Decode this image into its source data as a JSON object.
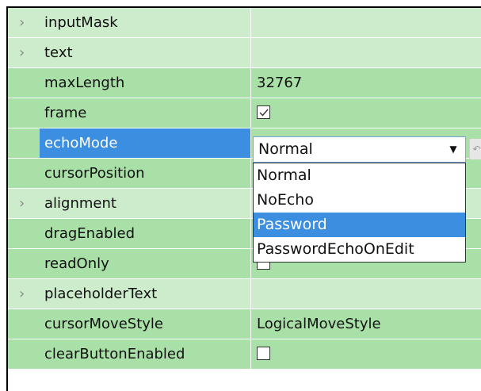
{
  "properties": [
    {
      "name": "inputMask",
      "value": "",
      "expandable": true,
      "kind": "text"
    },
    {
      "name": "text",
      "value": "",
      "expandable": true,
      "kind": "text"
    },
    {
      "name": "maxLength",
      "value": "32767",
      "expandable": false,
      "kind": "text"
    },
    {
      "name": "frame",
      "value": "",
      "expandable": false,
      "kind": "checkbox",
      "checked": true
    },
    {
      "name": "echoMode",
      "value": "",
      "expandable": false,
      "kind": "combo",
      "selected": true
    },
    {
      "name": "cursorPosition",
      "value": "",
      "expandable": false,
      "kind": "text"
    },
    {
      "name": "alignment",
      "value": "",
      "expandable": true,
      "kind": "text"
    },
    {
      "name": "dragEnabled",
      "value": "",
      "expandable": false,
      "kind": "text"
    },
    {
      "name": "readOnly",
      "value": "",
      "expandable": false,
      "kind": "checkbox",
      "checked": false
    },
    {
      "name": "placeholderText",
      "value": "",
      "expandable": true,
      "kind": "text"
    },
    {
      "name": "cursorMoveStyle",
      "value": "LogicalMoveStyle",
      "expandable": false,
      "kind": "text"
    },
    {
      "name": "clearButtonEnabled",
      "value": "",
      "expandable": false,
      "kind": "checkbox",
      "checked": false
    }
  ],
  "combo": {
    "current": "Normal",
    "options": [
      "Normal",
      "NoEcho",
      "Password",
      "PasswordEchoOnEdit"
    ],
    "highlighted": "Password"
  },
  "colors": {
    "row_light": "#cdeccc",
    "row_dark": "#a9e0a7",
    "selection": "#3c8fe0"
  },
  "icons": {
    "expand": "chevron-right-icon",
    "combo_arrow": "triangle-down-icon",
    "reset": "reset-arrow-icon",
    "check": "checkmark-icon"
  }
}
